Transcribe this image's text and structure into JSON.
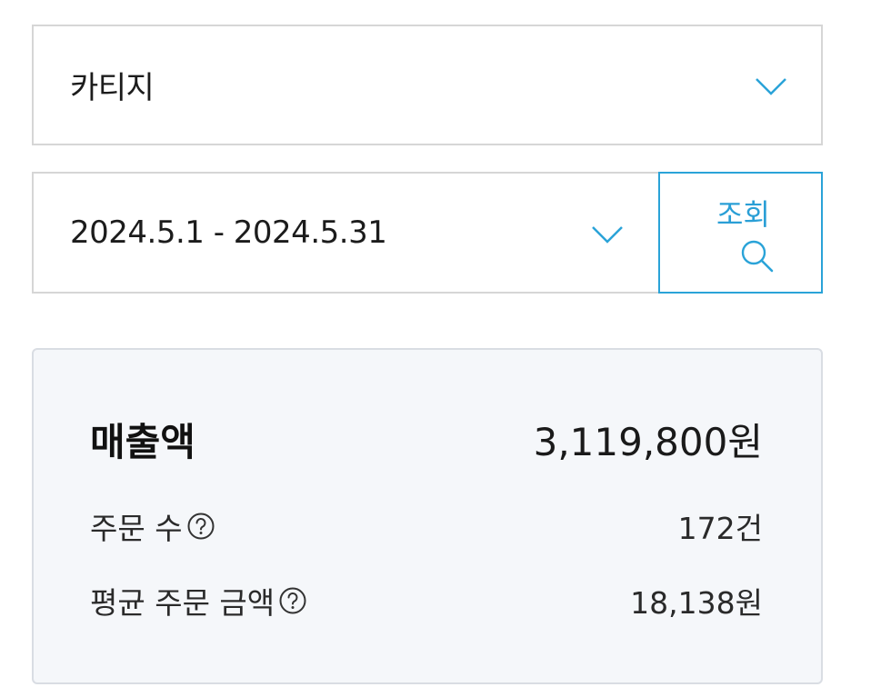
{
  "filters": {
    "category": {
      "selected": "카티지",
      "icon": "chevron-down-icon"
    },
    "date_range": {
      "selected": "2024.5.1 - 2024.5.31",
      "icon": "chevron-down-icon"
    },
    "search_button": {
      "label": "조회",
      "icon": "search-icon"
    }
  },
  "summary": {
    "sales": {
      "label": "매출액",
      "value": "3,119,800원"
    },
    "orders": {
      "label": "주문 수",
      "value": "172건",
      "icon": "help-icon"
    },
    "avg_order": {
      "label": "평균 주문 금액",
      "value": "18,138원",
      "icon": "help-icon"
    }
  },
  "colors": {
    "accent": "#2aa3d8",
    "border": "#d6d6d6",
    "card_bg": "#f5f7fa"
  }
}
